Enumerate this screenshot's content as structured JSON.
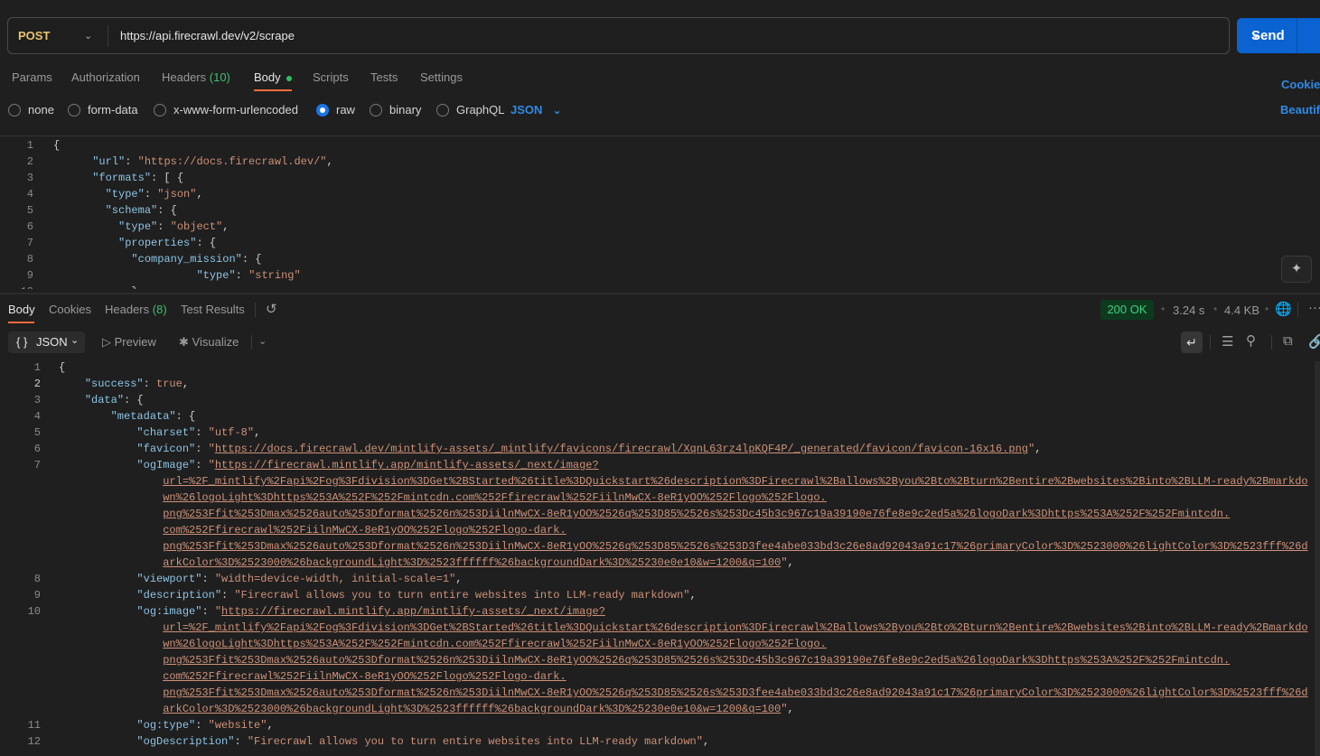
{
  "request": {
    "method": "POST",
    "url": "https://api.firecrawl.dev/v2/scrape",
    "send_label": "Send",
    "tabs": [
      {
        "label": "Params"
      },
      {
        "label": "Authorization"
      },
      {
        "label": "Headers",
        "count": "(10)"
      },
      {
        "label": "Body"
      },
      {
        "label": "Scripts"
      },
      {
        "label": "Tests"
      },
      {
        "label": "Settings"
      }
    ],
    "cookies_link": "Cookies",
    "beautify_link": "Beautify",
    "body_types": [
      "none",
      "form-data",
      "x-www-form-urlencoded",
      "raw",
      "binary",
      "GraphQL"
    ],
    "selected_body_type": "raw",
    "raw_format": "JSON",
    "lines": [
      {
        "n": "1",
        "t": [
          [
            "p",
            "{"
          ]
        ]
      },
      {
        "n": "2",
        "t": [
          [
            "w",
            "      "
          ],
          [
            "k",
            "\"url\""
          ],
          [
            "p",
            ": "
          ],
          [
            "s",
            "\"https://docs.firecrawl.dev/\""
          ],
          [
            "p",
            ","
          ]
        ]
      },
      {
        "n": "3",
        "t": [
          [
            "w",
            "      "
          ],
          [
            "k",
            "\"formats\""
          ],
          [
            "p",
            ": [ {"
          ]
        ]
      },
      {
        "n": "4",
        "t": [
          [
            "w",
            "        "
          ],
          [
            "k",
            "\"type\""
          ],
          [
            "p",
            ": "
          ],
          [
            "s",
            "\"json\""
          ],
          [
            "p",
            ","
          ]
        ]
      },
      {
        "n": "5",
        "t": [
          [
            "w",
            "        "
          ],
          [
            "k",
            "\"schema\""
          ],
          [
            "p",
            ": {"
          ]
        ]
      },
      {
        "n": "6",
        "t": [
          [
            "w",
            "          "
          ],
          [
            "k",
            "\"type\""
          ],
          [
            "p",
            ": "
          ],
          [
            "s",
            "\"object\""
          ],
          [
            "p",
            ","
          ]
        ]
      },
      {
        "n": "7",
        "t": [
          [
            "w",
            "          "
          ],
          [
            "k",
            "\"properties\""
          ],
          [
            "p",
            ": {"
          ]
        ]
      },
      {
        "n": "8",
        "t": [
          [
            "w",
            "            "
          ],
          [
            "k",
            "\"company_mission\""
          ],
          [
            "p",
            ": {"
          ]
        ]
      },
      {
        "n": "9",
        "t": [
          [
            "w",
            "                      "
          ],
          [
            "k",
            "\"type\""
          ],
          [
            "p",
            ": "
          ],
          [
            "s",
            "\"string\""
          ]
        ]
      },
      {
        "n": "10",
        "t": [
          [
            "w",
            "            "
          ],
          [
            "p",
            "}"
          ]
        ]
      }
    ]
  },
  "response": {
    "tabs": [
      {
        "label": "Body"
      },
      {
        "label": "Cookies"
      },
      {
        "label": "Headers",
        "count": "(8)"
      },
      {
        "label": "Test Results"
      }
    ],
    "status": "200 OK",
    "time": "3.24 s",
    "size": "4.4 KB",
    "format": "JSON",
    "preview_label": "Preview",
    "visualize_label": "Visualize",
    "lines": [
      {
        "n": "1",
        "t": [
          [
            "p",
            "{"
          ]
        ]
      },
      {
        "n": "2",
        "cur": true,
        "t": [
          [
            "w",
            "    "
          ],
          [
            "k",
            "\"success\""
          ],
          [
            "p",
            ": "
          ],
          [
            "b",
            "true"
          ],
          [
            "p",
            ","
          ]
        ]
      },
      {
        "n": "3",
        "t": [
          [
            "w",
            "    "
          ],
          [
            "k",
            "\"data\""
          ],
          [
            "p",
            ": {"
          ]
        ]
      },
      {
        "n": "4",
        "t": [
          [
            "w",
            "        "
          ],
          [
            "k",
            "\"metadata\""
          ],
          [
            "p",
            ": {"
          ]
        ]
      },
      {
        "n": "5",
        "t": [
          [
            "w",
            "            "
          ],
          [
            "k",
            "\"charset\""
          ],
          [
            "p",
            ": "
          ],
          [
            "s",
            "\"utf-8\""
          ],
          [
            "p",
            ","
          ]
        ]
      },
      {
        "n": "6",
        "t": [
          [
            "w",
            "            "
          ],
          [
            "k",
            "\"favicon\""
          ],
          [
            "p",
            ": "
          ],
          [
            "s",
            "\""
          ],
          [
            "u",
            "https://docs.firecrawl.dev/mintlify-assets/_mintlify/favicons/firecrawl/XqnL63rz4lpKQF4P/_generated/favicon/favicon-16x16.png"
          ],
          [
            "s",
            "\""
          ],
          [
            "p",
            ","
          ]
        ]
      },
      {
        "n": "7",
        "t": [
          [
            "w",
            "            "
          ],
          [
            "k",
            "\"ogImage\""
          ],
          [
            "p",
            ": "
          ],
          [
            "s",
            "\""
          ],
          [
            "u",
            "https://firecrawl.mintlify.app/mintlify-assets/_next/image?"
          ]
        ]
      },
      {
        "n": "",
        "t": [
          [
            "w",
            "                "
          ],
          [
            "u",
            "url=%2F_mintlify%2Fapi%2Fog%3Fdivision%3DGet%2BStarted%26title%3DQuickstart%26description%3DFirecrawl%2Ballows%2Byou%2Bto%2Bturn%2Bentire%2Bwebsites%2Binto%2BLLM-ready%2Bmarkdo"
          ]
        ]
      },
      {
        "n": "",
        "t": [
          [
            "w",
            "                "
          ],
          [
            "u",
            "wn%26logoLight%3Dhttps%253A%252F%252Fmintcdn.com%252Ffirecrawl%252FiilnMwCX-8eR1yOO%252Flogo%252Flogo."
          ]
        ]
      },
      {
        "n": "",
        "t": [
          [
            "w",
            "                "
          ],
          [
            "u",
            "png%253Ffit%253Dmax%2526auto%253Dformat%2526n%253DiilnMwCX-8eR1yOO%2526q%253D85%2526s%253Dc45b3c967c19a39190e76fe8e9c2ed5a%26logoDark%3Dhttps%253A%252F%252Fmintcdn."
          ]
        ]
      },
      {
        "n": "",
        "t": [
          [
            "w",
            "                "
          ],
          [
            "u",
            "com%252Ffirecrawl%252FiilnMwCX-8eR1yOO%252Flogo%252Flogo-dark."
          ]
        ]
      },
      {
        "n": "",
        "t": [
          [
            "w",
            "                "
          ],
          [
            "u",
            "png%253Ffit%253Dmax%2526auto%253Dformat%2526n%253DiilnMwCX-8eR1yOO%2526q%253D85%2526s%253D3fee4abe033bd3c26e8ad92043a91c17%26primaryColor%3D%2523000%26lightColor%3D%2523fff%26d"
          ]
        ]
      },
      {
        "n": "",
        "t": [
          [
            "w",
            "                "
          ],
          [
            "u",
            "arkColor%3D%2523000%26backgroundLight%3D%2523ffffff%26backgroundDark%3D%25230e0e10&w=1200&q=100"
          ],
          [
            "s",
            "\""
          ],
          [
            "p",
            ","
          ]
        ]
      },
      {
        "n": "8",
        "t": [
          [
            "w",
            "            "
          ],
          [
            "k",
            "\"viewport\""
          ],
          [
            "p",
            ": "
          ],
          [
            "s",
            "\"width=device-width, initial-scale=1\""
          ],
          [
            "p",
            ","
          ]
        ]
      },
      {
        "n": "9",
        "t": [
          [
            "w",
            "            "
          ],
          [
            "k",
            "\"description\""
          ],
          [
            "p",
            ": "
          ],
          [
            "s",
            "\"Firecrawl allows you to turn entire websites into LLM-ready markdown\""
          ],
          [
            "p",
            ","
          ]
        ]
      },
      {
        "n": "10",
        "t": [
          [
            "w",
            "            "
          ],
          [
            "k",
            "\"og:image\""
          ],
          [
            "p",
            ": "
          ],
          [
            "s",
            "\""
          ],
          [
            "u",
            "https://firecrawl.mintlify.app/mintlify-assets/_next/image?"
          ]
        ]
      },
      {
        "n": "",
        "t": [
          [
            "w",
            "                "
          ],
          [
            "u",
            "url=%2F_mintlify%2Fapi%2Fog%3Fdivision%3DGet%2BStarted%26title%3DQuickstart%26description%3DFirecrawl%2Ballows%2Byou%2Bto%2Bturn%2Bentire%2Bwebsites%2Binto%2BLLM-ready%2Bmarkdo"
          ]
        ]
      },
      {
        "n": "",
        "t": [
          [
            "w",
            "                "
          ],
          [
            "u",
            "wn%26logoLight%3Dhttps%253A%252F%252Fmintcdn.com%252Ffirecrawl%252FiilnMwCX-8eR1yOO%252Flogo%252Flogo."
          ]
        ]
      },
      {
        "n": "",
        "t": [
          [
            "w",
            "                "
          ],
          [
            "u",
            "png%253Ffit%253Dmax%2526auto%253Dformat%2526n%253DiilnMwCX-8eR1yOO%2526q%253D85%2526s%253Dc45b3c967c19a39190e76fe8e9c2ed5a%26logoDark%3Dhttps%253A%252F%252Fmintcdn."
          ]
        ]
      },
      {
        "n": "",
        "t": [
          [
            "w",
            "                "
          ],
          [
            "u",
            "com%252Ffirecrawl%252FiilnMwCX-8eR1yOO%252Flogo%252Flogo-dark."
          ]
        ]
      },
      {
        "n": "",
        "t": [
          [
            "w",
            "                "
          ],
          [
            "u",
            "png%253Ffit%253Dmax%2526auto%253Dformat%2526n%253DiilnMwCX-8eR1yOO%2526q%253D85%2526s%253D3fee4abe033bd3c26e8ad92043a91c17%26primaryColor%3D%2523000%26lightColor%3D%2523fff%26d"
          ]
        ]
      },
      {
        "n": "",
        "t": [
          [
            "w",
            "                "
          ],
          [
            "u",
            "arkColor%3D%2523000%26backgroundLight%3D%2523ffffff%26backgroundDark%3D%25230e0e10&w=1200&q=100"
          ],
          [
            "s",
            "\""
          ],
          [
            "p",
            ","
          ]
        ]
      },
      {
        "n": "11",
        "t": [
          [
            "w",
            "            "
          ],
          [
            "k",
            "\"og:type\""
          ],
          [
            "p",
            ": "
          ],
          [
            "s",
            "\"website\""
          ],
          [
            "p",
            ","
          ]
        ]
      },
      {
        "n": "12",
        "t": [
          [
            "w",
            "            "
          ],
          [
            "k",
            "\"ogDescription\""
          ],
          [
            "p",
            ": "
          ],
          [
            "s",
            "\"Firecrawl allows you to turn entire websites into LLM-ready markdown\""
          ],
          [
            "p",
            ","
          ]
        ]
      }
    ]
  },
  "colors": {
    "accent": "#0a63d1",
    "status_ok": "#3fcf7d",
    "tab_underline": "#f26b3a",
    "method": "#e9c46a"
  }
}
